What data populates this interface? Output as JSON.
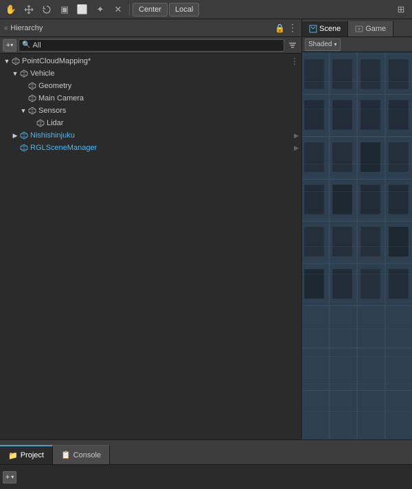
{
  "toolbar": {
    "icons": [
      "✋",
      "⊕",
      "↺",
      "▣",
      "⬜",
      "✦",
      "✕"
    ],
    "center_label": "Center",
    "local_label": "Local",
    "grid_icon": "⊞"
  },
  "hierarchy_panel": {
    "title": "Hierarchy",
    "lock_icon": "🔒",
    "menu_icon": "⋮",
    "add_label": "+",
    "search_placeholder": "All",
    "filter_icon": "▼"
  },
  "scene_panel": {
    "scene_tab": "Scene",
    "game_tab": "Game",
    "shaded_label": "Shaded"
  },
  "tree": [
    {
      "id": "pointcloud",
      "label": "PointCloudMapping*",
      "indent": 0,
      "arrow": "expanded",
      "icon": "cube",
      "icon_color": "gray",
      "selected": false,
      "has_arrow": true,
      "menu": true
    },
    {
      "id": "vehicle",
      "label": "Vehicle",
      "indent": 1,
      "arrow": "expanded",
      "icon": "cube",
      "icon_color": "gray",
      "selected": false
    },
    {
      "id": "geometry",
      "label": "Geometry",
      "indent": 2,
      "arrow": "none",
      "icon": "cube",
      "icon_color": "gray",
      "selected": false
    },
    {
      "id": "maincamera",
      "label": "Main Camera",
      "indent": 2,
      "arrow": "none",
      "icon": "cube",
      "icon_color": "gray",
      "selected": false
    },
    {
      "id": "sensors",
      "label": "Sensors",
      "indent": 2,
      "arrow": "expanded",
      "icon": "cube",
      "icon_color": "gray",
      "selected": false
    },
    {
      "id": "lidar",
      "label": "Lidar",
      "indent": 3,
      "arrow": "none",
      "icon": "cube",
      "icon_color": "gray",
      "selected": false
    },
    {
      "id": "nishishinjuku",
      "label": "Nishishinjuku",
      "indent": 1,
      "arrow": "collapsed",
      "icon": "cube",
      "icon_color": "blue",
      "selected": false,
      "label_color": "blue",
      "has_right_arrow": true
    },
    {
      "id": "rglscenemanager",
      "label": "RGLSceneManager",
      "indent": 1,
      "arrow": "none",
      "icon": "cube",
      "icon_color": "blue",
      "selected": false,
      "label_color": "blue",
      "has_right_arrow": true
    }
  ],
  "bottom": {
    "project_tab": "Project",
    "console_tab": "Console",
    "add_label": "+",
    "add_arrow": "▾"
  }
}
